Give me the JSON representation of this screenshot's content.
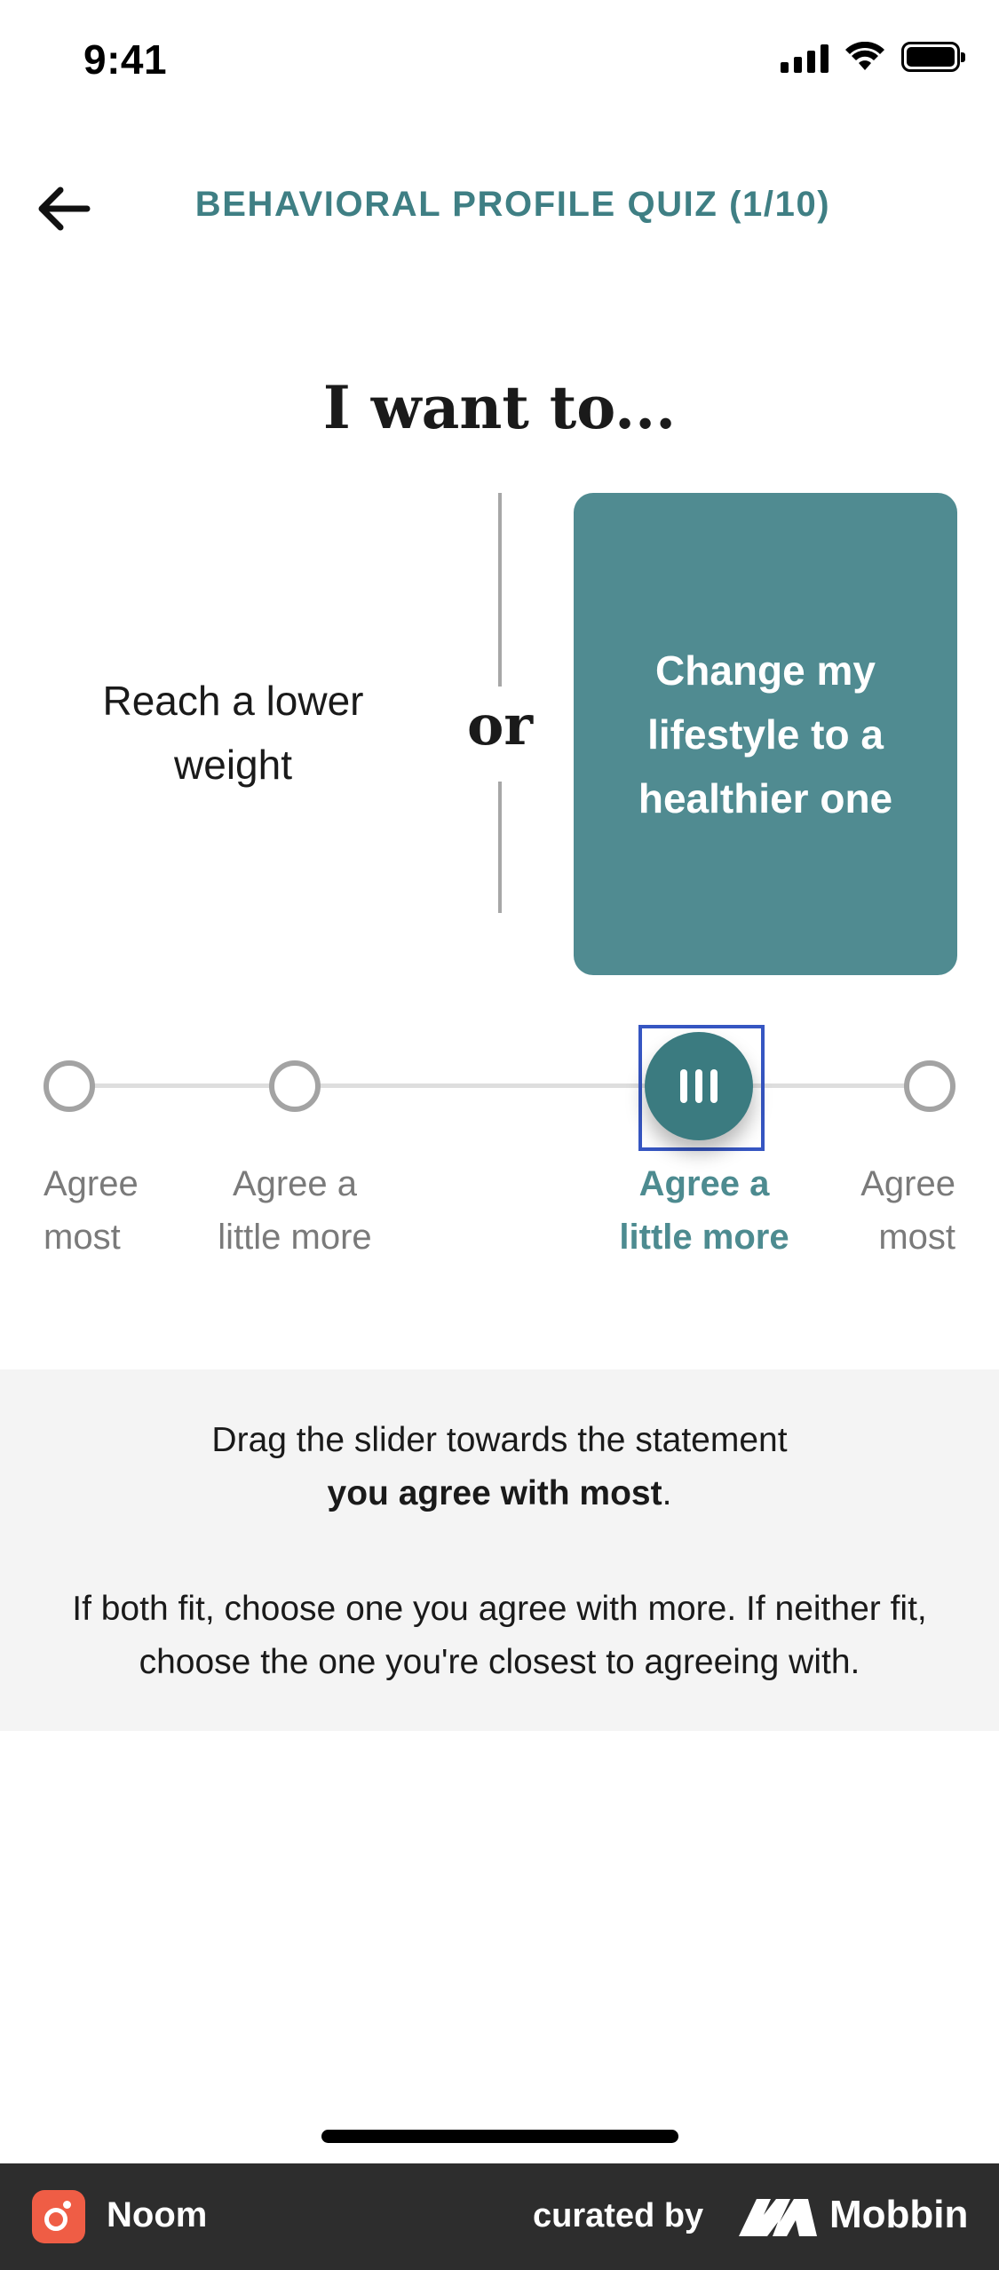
{
  "status_bar": {
    "time": "9:41"
  },
  "header": {
    "title": "BEHAVIORAL PROFILE QUIZ (1/10)"
  },
  "question": {
    "text": "I want to..."
  },
  "statements": {
    "left": "Reach a lower weight",
    "separator": "or",
    "right": "Change my lifestyle to a healthier one",
    "selected": "right"
  },
  "slider": {
    "labels": [
      {
        "line1": "Agree",
        "line2": "most"
      },
      {
        "line1": "Agree a",
        "line2": "little more"
      },
      {
        "line1": "Agree a",
        "line2": "little more"
      },
      {
        "line1": "Agree",
        "line2": "most"
      }
    ],
    "selected_index": 2
  },
  "instructions": {
    "line1": "Drag the slider towards the statement",
    "line2_bold": "you agree with most",
    "line2_suffix": ".",
    "paragraph": "If both fit, choose one you agree with more. If neither fit, choose the one you're closest to agreeing with."
  },
  "footer": {
    "app_name": "Noom",
    "curated_by": "curated by",
    "brand": "Mobbin"
  },
  "colors": {
    "accent": "#3f7f84",
    "card": "#508b91",
    "handle": "#3b7b80",
    "focus_outline": "#3656c2",
    "panel": "#f4f4f4",
    "footer": "#2d2d2d",
    "app_logo": "#ef5d45"
  },
  "icons": {
    "back": "arrow-left-icon",
    "handle": "grip-lines-icon",
    "signal": "cellular-signal-icon",
    "wifi": "wifi-icon",
    "battery": "battery-icon"
  }
}
